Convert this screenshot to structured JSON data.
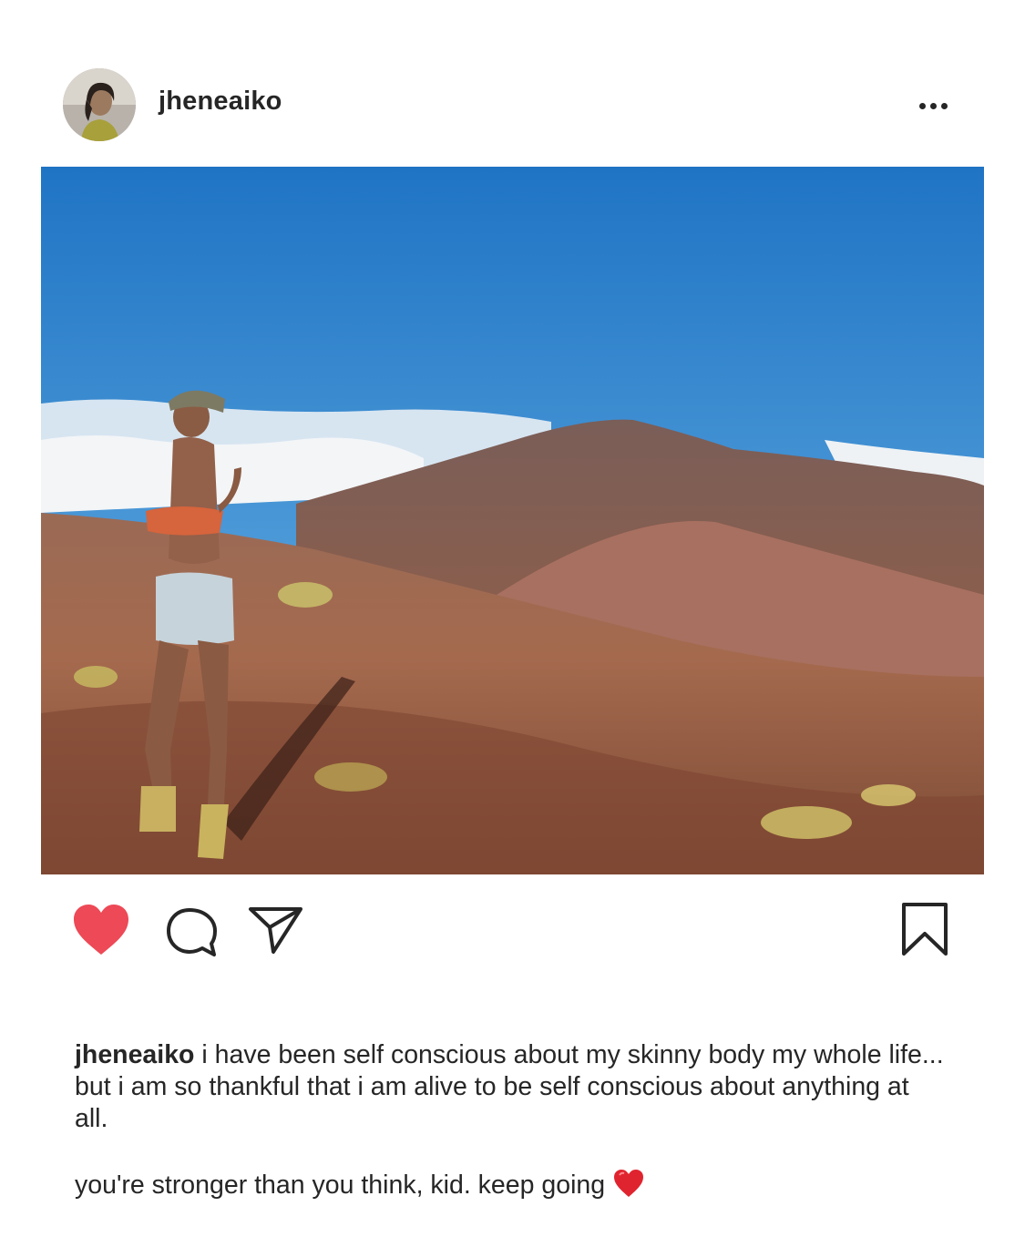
{
  "post": {
    "username": "jheneaiko",
    "avatar_alt": "profile-photo",
    "more_icon": "more-horizontal-icon",
    "caption": {
      "username": "jheneaiko",
      "text": "i have been self conscious about my skinny body my whole life... but i am so thankful that i am alive to be self conscious about anything at all.",
      "second_line": "you're stronger than you think, kid. keep going"
    },
    "liked": true
  },
  "icons": {
    "like": "heart-icon",
    "comment": "comment-icon",
    "share": "send-icon",
    "save": "bookmark-icon",
    "caption_emoji": "red-heart-emoji"
  },
  "colors": {
    "like_red": "#ed4956",
    "text": "#262626",
    "emoji_red": "#e0242f"
  }
}
